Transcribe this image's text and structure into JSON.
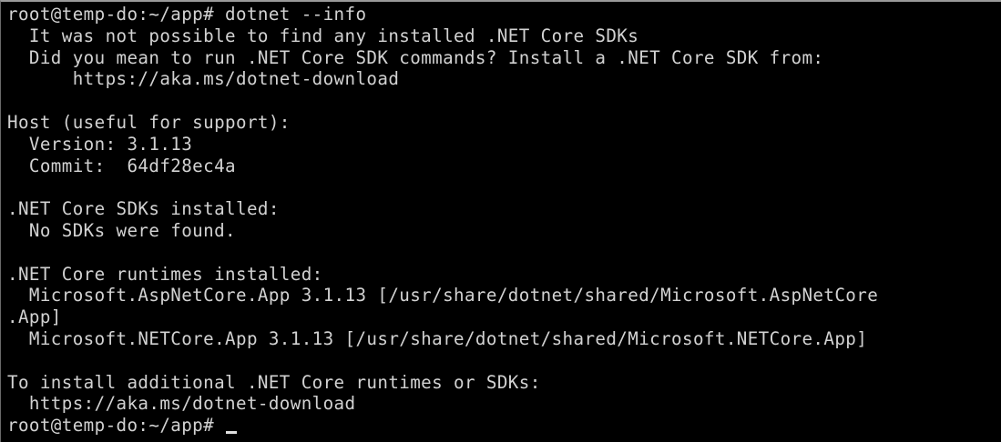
{
  "terminal": {
    "lines": [
      "root@temp-do:~/app# dotnet --info",
      "  It was not possible to find any installed .NET Core SDKs",
      "  Did you mean to run .NET Core SDK commands? Install a .NET Core SDK from:",
      "      https://aka.ms/dotnet-download",
      "",
      "Host (useful for support):",
      "  Version: 3.1.13",
      "  Commit:  64df28ec4a",
      "",
      ".NET Core SDKs installed:",
      "  No SDKs were found.",
      "",
      ".NET Core runtimes installed:",
      "  Microsoft.AspNetCore.App 3.1.13 [/usr/share/dotnet/shared/Microsoft.AspNetCore",
      ".App]",
      "  Microsoft.NETCore.App 3.1.13 [/usr/share/dotnet/shared/Microsoft.NETCore.App]",
      "",
      "To install additional .NET Core runtimes or SDKs:",
      "  https://aka.ms/dotnet-download"
    ],
    "prompt": "root@temp-do:~/app# "
  }
}
